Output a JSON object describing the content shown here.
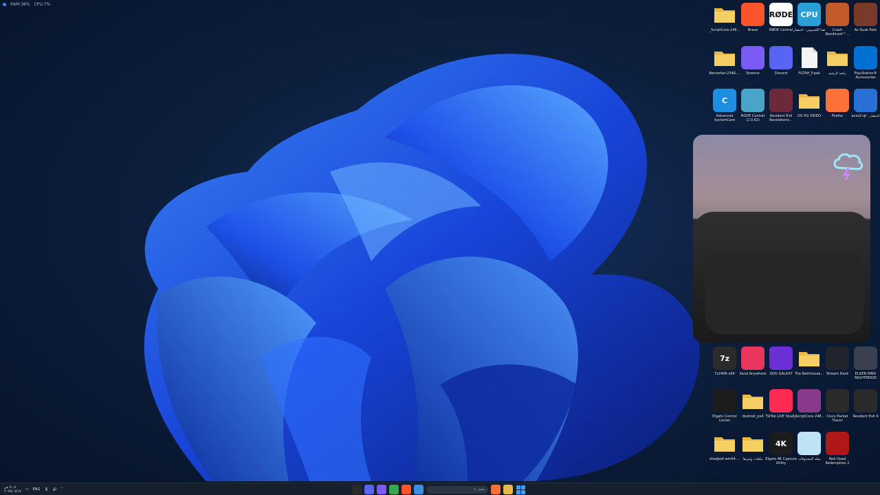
{
  "perf_overlay": {
    "ram": "RAM:38%",
    "cpu": "CPU:7%"
  },
  "desktop_icons": [
    {
      "label": "_ScriptCore-248...",
      "icon": "folder-icon",
      "color": "#e8b84a"
    },
    {
      "label": "Brave",
      "icon": "brave-icon",
      "color": "#fb542b"
    },
    {
      "label": "RØDE Central",
      "icon": "rode-icon",
      "color": "#ffffff",
      "text": "RØDE"
    },
    {
      "label": "هذا الكمبيوتر - اختصار",
      "icon": "cpu-icon",
      "color": "#2a9fd6",
      "text": "CPU"
    },
    {
      "label": "Crash Bandicoot™...",
      "icon": "crash-icon",
      "color": "#c45a2a"
    },
    {
      "label": "As Dusk Falls",
      "icon": "game-icon",
      "color": "#7a3a2a"
    },
    {
      "label": "Berserker-2346-...",
      "icon": "folder-icon",
      "color": "#e8b84a"
    },
    {
      "label": "Stremio",
      "icon": "stremio-icon",
      "color": "#7b5bf5"
    },
    {
      "label": "Discord",
      "icon": "discord-icon",
      "color": "#5865f2"
    },
    {
      "label": "FILTAH_P.pak",
      "icon": "file-icon",
      "color": "#f2f2f2"
    },
    {
      "label": "راشد الرشيد",
      "icon": "user-folder-icon",
      "color": "#e8b84a"
    },
    {
      "label": "PlayStation® Accessories",
      "icon": "playstation-icon",
      "color": "#0070d1"
    },
    {
      "label": "Advanced SystemCare",
      "icon": "asc-icon",
      "color": "#1e8fe0",
      "text": "C"
    },
    {
      "label": "RODE Central (2.0.62)",
      "icon": "setup-icon",
      "color": "#4aa3c8"
    },
    {
      "label": "Resident Evil Revelations...",
      "icon": "re-icon",
      "color": "#6a2a3a"
    },
    {
      "label": "DS HD VIDEO",
      "icon": "folder-icon",
      "color": "#e8b84a"
    },
    {
      "label": "Firefox",
      "icon": "firefox-icon",
      "color": "#ff7139"
    },
    {
      "label": "pcsx2-qt - اختصار",
      "icon": "pcsx2-icon",
      "color": "#2a6fd6"
    },
    {
      "label": "7z2406-x64",
      "icon": "7zip-icon",
      "color": "#2b2b2b",
      "text": "7z"
    },
    {
      "label": "Send Anywhere",
      "icon": "send-anywhere-icon",
      "color": "#e8365d"
    },
    {
      "label": "GOG GALAXY",
      "icon": "gog-icon",
      "color": "#6b2fd6"
    },
    {
      "label": "The.Bathhouse...",
      "icon": "folder-icon",
      "color": "#e8b84a"
    },
    {
      "label": "Stream Deck",
      "icon": "stream-deck-icon",
      "color": "#20242c"
    },
    {
      "label": "ELDEN RING NIGHTREIGN",
      "icon": "elden-ring-icon",
      "color": "#3a4050"
    },
    {
      "label": "Elgato Control Center",
      "icon": "elgato-icon",
      "color": "#1c1c1c"
    },
    {
      "label": "dxdroot_ps4",
      "icon": "folder-icon",
      "color": "#e8b84a"
    },
    {
      "label": "TikTok LIVE Studio",
      "icon": "tiktok-icon",
      "color": "#fe2c55"
    },
    {
      "label": "_ScriptCore-248...",
      "icon": "winrar-icon",
      "color": "#8a3a8a"
    },
    {
      "label": "Cisco Packet Tracer",
      "icon": "cisco-icon",
      "color": "#2a2a2a"
    },
    {
      "label": "Resident Evil 4",
      "icon": "re4-icon",
      "color": "#2a2a2a"
    },
    {
      "label": "shadps4-win64-...",
      "icon": "folder-icon",
      "color": "#e8b84a"
    },
    {
      "label": "ملفات وغيرها",
      "icon": "folder-icon",
      "color": "#e8b84a"
    },
    {
      "label": "Elgato 4K Capture Utility",
      "icon": "elgato-4k-icon",
      "color": "#1c1c1c",
      "text": "4K"
    },
    {
      "label": "سلة المحذوفات",
      "icon": "recycle-bin-icon",
      "color": "#bfe3f5"
    },
    {
      "label": "Red Dead Redemption 2",
      "icon": "rdr2-icon",
      "color": "#b01818"
    }
  ],
  "taskbar": {
    "language": "ENG",
    "time": "٩:٠٤ ص",
    "date": "٢٠٢٥/٠٧/١٧",
    "search_placeholder": "بحث",
    "apps": [
      {
        "name": "obs-icon",
        "color": "#2a2a2a"
      },
      {
        "name": "chat-icon",
        "color": "#5865f2"
      },
      {
        "name": "stremio-icon",
        "color": "#7b5bf5"
      },
      {
        "name": "chrome-icon",
        "color": "#34a853"
      },
      {
        "name": "brave-icon",
        "color": "#fb542b"
      },
      {
        "name": "store-icon",
        "color": "#3a8ee6"
      },
      {
        "name": "firefox-icon",
        "color": "#ff7139"
      },
      {
        "name": "explorer-icon",
        "color": "#e8b84a"
      }
    ]
  }
}
